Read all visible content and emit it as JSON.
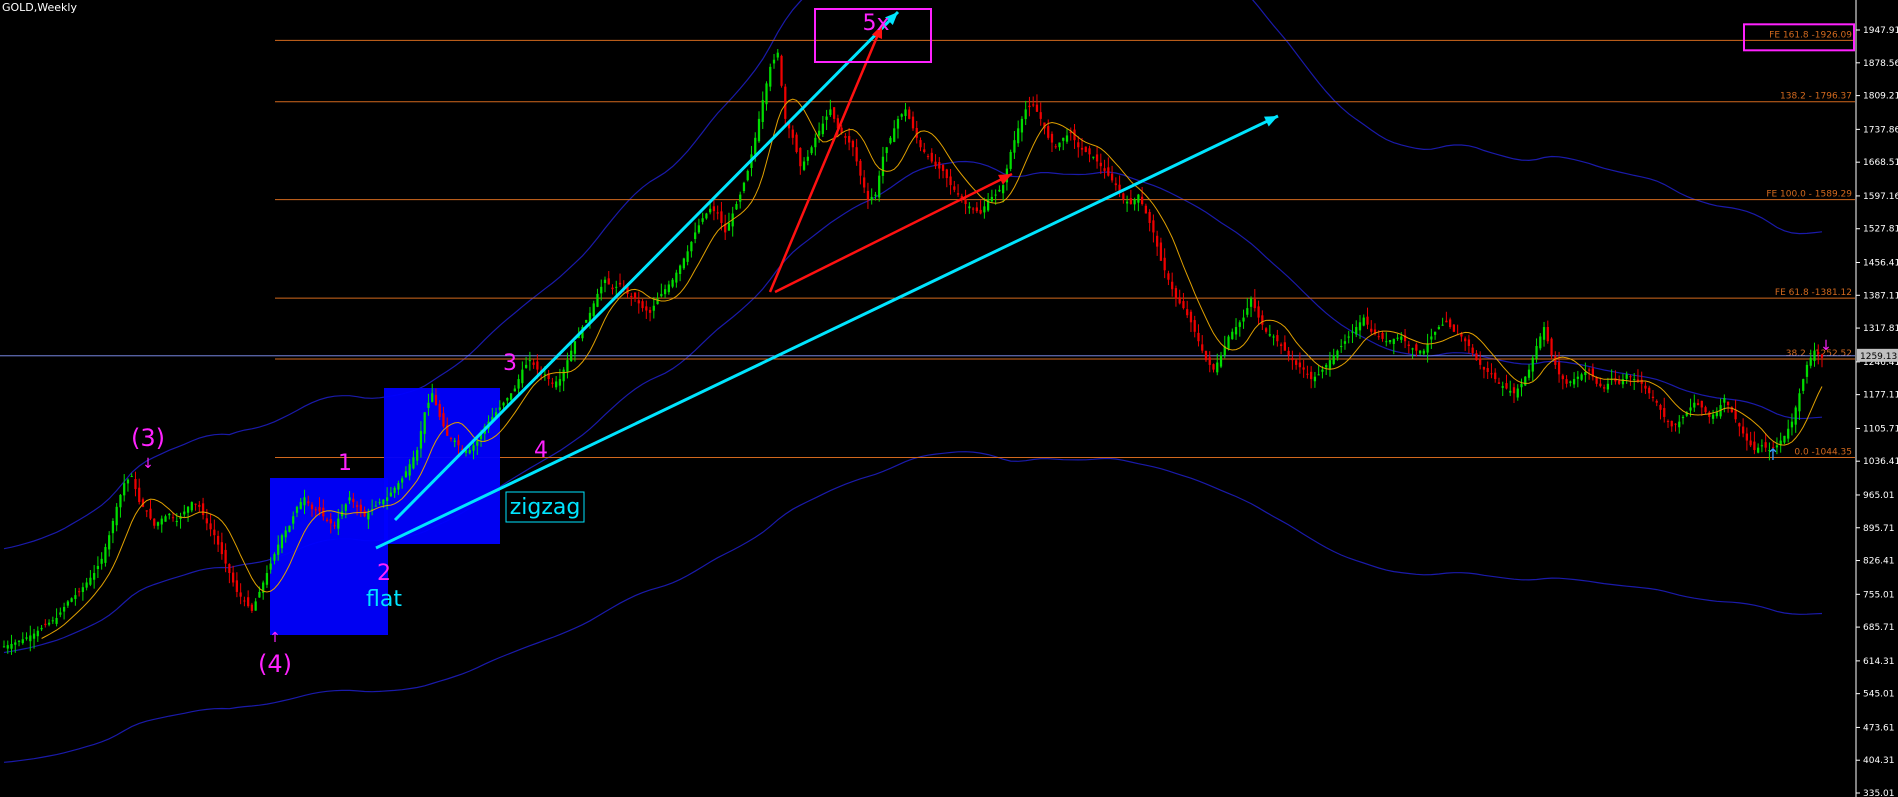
{
  "window": {
    "symbol_title": "GOLD,Weekly"
  },
  "colors": {
    "background": "#000000",
    "bull_candle": "#00dd00",
    "bear_candle": "#ee0000",
    "moving_average": "#e0a000",
    "bollinger": "#1a1aaa",
    "fib_line": "#d2691e",
    "trend_line": "#00e5ff",
    "red_line": "#ff1111",
    "wave_label": "#ff22ff",
    "box_fill": "#0000ff",
    "price_axis_text": "#ffffff",
    "current_price_bg": "#c0c0c0"
  },
  "chart_data": {
    "type": "candlestick",
    "symbol": "GOLD",
    "timeframe": "Weekly",
    "ylim": [
      335.01,
      2016.0
    ],
    "current_price": 1259.13,
    "y_ticks": [
      "1947.91",
      "1878.56",
      "1809.21",
      "1737.86",
      "1668.51",
      "1597.16",
      "1527.81",
      "1456.41",
      "1387.11",
      "1317.81",
      "1246.41",
      "1177.11",
      "1105.71",
      "1036.41",
      "965.01",
      "895.71",
      "826.41",
      "755.01",
      "685.71",
      "614.31",
      "545.01",
      "473.61",
      "404.31",
      "335.01"
    ],
    "fib_levels": [
      {
        "label": "FE 161.8 -1926.09",
        "price": 1926.09,
        "boxed": true
      },
      {
        "label": "138.2 - 1796.37",
        "price": 1796.37,
        "boxed": false
      },
      {
        "label": "FE 100.0 - 1589.29",
        "price": 1589.29,
        "boxed": false
      },
      {
        "label": "FE 61.8 -1381.12",
        "price": 1381.12,
        "boxed": false
      },
      {
        "label": "38.2 - 1252.52",
        "price": 1252.52,
        "boxed": false
      },
      {
        "label": "0.0 -1044.35",
        "price": 1044.35,
        "boxed": false
      }
    ],
    "wave_labels": [
      {
        "text": "(3)",
        "kind": "wave",
        "arrow": "down"
      },
      {
        "text": "(4)",
        "kind": "wave",
        "arrow": "up"
      },
      {
        "text": "1",
        "kind": "wave"
      },
      {
        "text": "2",
        "kind": "wave"
      },
      {
        "text": "3",
        "kind": "wave"
      },
      {
        "text": "4",
        "kind": "wave"
      },
      {
        "text": "5x",
        "kind": "wave",
        "boxed": true
      },
      {
        "text": "flat",
        "kind": "pattern"
      },
      {
        "text": "zigzag",
        "kind": "pattern",
        "boxed": true
      }
    ],
    "close_path": [
      [
        0,
        645
      ],
      [
        2,
        650
      ],
      [
        5,
        660
      ],
      [
        8,
        672
      ],
      [
        11,
        690
      ],
      [
        14,
        705
      ],
      [
        17,
        740
      ],
      [
        20,
        760
      ],
      [
        22,
        780
      ],
      [
        24,
        800
      ],
      [
        26,
        830
      ],
      [
        28,
        880
      ],
      [
        30,
        940
      ],
      [
        32,
        990
      ],
      [
        34,
        1005
      ],
      [
        36,
        950
      ],
      [
        38,
        930
      ],
      [
        40,
        900
      ],
      [
        42,
        915
      ],
      [
        44,
        925
      ],
      [
        46,
        910
      ],
      [
        48,
        930
      ],
      [
        50,
        950
      ],
      [
        52,
        940
      ],
      [
        54,
        905
      ],
      [
        56,
        880
      ],
      [
        58,
        840
      ],
      [
        60,
        800
      ],
      [
        62,
        760
      ],
      [
        64,
        740
      ],
      [
        66,
        720
      ],
      [
        68,
        760
      ],
      [
        70,
        800
      ],
      [
        72,
        840
      ],
      [
        74,
        880
      ],
      [
        76,
        900
      ],
      [
        78,
        940
      ],
      [
        80,
        960
      ],
      [
        82,
        935
      ],
      [
        84,
        930
      ],
      [
        86,
        910
      ],
      [
        88,
        900
      ],
      [
        90,
        930
      ],
      [
        92,
        960
      ],
      [
        94,
        940
      ],
      [
        96,
        920
      ],
      [
        98,
        935
      ],
      [
        100,
        950
      ],
      [
        102,
        960
      ],
      [
        104,
        980
      ],
      [
        106,
        1000
      ],
      [
        108,
        1030
      ],
      [
        110,
        1060
      ],
      [
        112,
        1140
      ],
      [
        114,
        1180
      ],
      [
        116,
        1130
      ],
      [
        118,
        1090
      ],
      [
        120,
        1080
      ],
      [
        122,
        1060
      ],
      [
        124,
        1060
      ],
      [
        126,
        1080
      ],
      [
        128,
        1110
      ],
      [
        130,
        1130
      ],
      [
        132,
        1150
      ],
      [
        134,
        1170
      ],
      [
        136,
        1190
      ],
      [
        138,
        1230
      ],
      [
        140,
        1250
      ],
      [
        142,
        1230
      ],
      [
        144,
        1220
      ],
      [
        146,
        1200
      ],
      [
        148,
        1210
      ],
      [
        150,
        1250
      ],
      [
        152,
        1290
      ],
      [
        154,
        1320
      ],
      [
        156,
        1350
      ],
      [
        158,
        1390
      ],
      [
        160,
        1420
      ],
      [
        162,
        1400
      ],
      [
        164,
        1410
      ],
      [
        166,
        1390
      ],
      [
        168,
        1380
      ],
      [
        170,
        1360
      ],
      [
        172,
        1350
      ],
      [
        174,
        1380
      ],
      [
        176,
        1400
      ],
      [
        178,
        1420
      ],
      [
        180,
        1450
      ],
      [
        182,
        1480
      ],
      [
        184,
        1520
      ],
      [
        186,
        1550
      ],
      [
        188,
        1570
      ],
      [
        190,
        1560
      ],
      [
        192,
        1520
      ],
      [
        194,
        1560
      ],
      [
        196,
        1600
      ],
      [
        198,
        1650
      ],
      [
        200,
        1720
      ],
      [
        202,
        1800
      ],
      [
        204,
        1870
      ],
      [
        206,
        1900
      ],
      [
        208,
        1760
      ],
      [
        210,
        1720
      ],
      [
        212,
        1660
      ],
      [
        214,
        1680
      ],
      [
        216,
        1720
      ],
      [
        218,
        1750
      ],
      [
        220,
        1780
      ],
      [
        222,
        1740
      ],
      [
        224,
        1720
      ],
      [
        226,
        1700
      ],
      [
        228,
        1640
      ],
      [
        230,
        1590
      ],
      [
        232,
        1600
      ],
      [
        234,
        1680
      ],
      [
        236,
        1720
      ],
      [
        238,
        1760
      ],
      [
        240,
        1780
      ],
      [
        242,
        1740
      ],
      [
        244,
        1700
      ],
      [
        246,
        1680
      ],
      [
        248,
        1660
      ],
      [
        250,
        1650
      ],
      [
        252,
        1620
      ],
      [
        254,
        1600
      ],
      [
        256,
        1580
      ],
      [
        258,
        1570
      ],
      [
        260,
        1560
      ],
      [
        262,
        1590
      ],
      [
        264,
        1600
      ],
      [
        266,
        1620
      ],
      [
        268,
        1690
      ],
      [
        270,
        1740
      ],
      [
        272,
        1780
      ],
      [
        274,
        1790
      ],
      [
        276,
        1760
      ],
      [
        278,
        1720
      ],
      [
        280,
        1700
      ],
      [
        282,
        1720
      ],
      [
        284,
        1730
      ],
      [
        286,
        1700
      ],
      [
        288,
        1690
      ],
      [
        290,
        1680
      ],
      [
        292,
        1660
      ],
      [
        294,
        1640
      ],
      [
        296,
        1620
      ],
      [
        298,
        1590
      ],
      [
        300,
        1580
      ],
      [
        302,
        1600
      ],
      [
        304,
        1560
      ],
      [
        306,
        1520
      ],
      [
        308,
        1460
      ],
      [
        310,
        1420
      ],
      [
        312,
        1380
      ],
      [
        314,
        1360
      ],
      [
        316,
        1330
      ],
      [
        318,
        1290
      ],
      [
        320,
        1250
      ],
      [
        322,
        1230
      ],
      [
        324,
        1260
      ],
      [
        326,
        1300
      ],
      [
        328,
        1320
      ],
      [
        330,
        1340
      ],
      [
        332,
        1380
      ],
      [
        334,
        1340
      ],
      [
        336,
        1310
      ],
      [
        338,
        1300
      ],
      [
        340,
        1280
      ],
      [
        342,
        1260
      ],
      [
        344,
        1240
      ],
      [
        346,
        1230
      ],
      [
        348,
        1210
      ],
      [
        350,
        1220
      ],
      [
        352,
        1240
      ],
      [
        354,
        1260
      ],
      [
        356,
        1280
      ],
      [
        358,
        1300
      ],
      [
        360,
        1320
      ],
      [
        362,
        1340
      ],
      [
        364,
        1310
      ],
      [
        366,
        1300
      ],
      [
        368,
        1290
      ],
      [
        370,
        1295
      ],
      [
        372,
        1300
      ],
      [
        374,
        1280
      ],
      [
        376,
        1270
      ],
      [
        378,
        1270
      ],
      [
        380,
        1300
      ],
      [
        382,
        1320
      ],
      [
        384,
        1330
      ],
      [
        386,
        1310
      ],
      [
        388,
        1300
      ],
      [
        390,
        1280
      ],
      [
        392,
        1250
      ],
      [
        394,
        1230
      ],
      [
        396,
        1220
      ],
      [
        398,
        1200
      ],
      [
        400,
        1190
      ],
      [
        402,
        1180
      ],
      [
        404,
        1200
      ],
      [
        406,
        1230
      ],
      [
        408,
        1280
      ],
      [
        410,
        1320
      ],
      [
        412,
        1260
      ],
      [
        414,
        1220
      ],
      [
        416,
        1200
      ],
      [
        418,
        1210
      ],
      [
        420,
        1220
      ],
      [
        422,
        1230
      ],
      [
        424,
        1200
      ],
      [
        426,
        1190
      ],
      [
        428,
        1210
      ],
      [
        430,
        1200
      ],
      [
        432,
        1220
      ],
      [
        434,
        1210
      ],
      [
        436,
        1200
      ],
      [
        438,
        1180
      ],
      [
        440,
        1160
      ],
      [
        442,
        1130
      ],
      [
        444,
        1110
      ],
      [
        446,
        1120
      ],
      [
        448,
        1140
      ],
      [
        450,
        1160
      ],
      [
        452,
        1150
      ],
      [
        454,
        1130
      ],
      [
        456,
        1140
      ],
      [
        458,
        1170
      ],
      [
        460,
        1140
      ],
      [
        462,
        1110
      ],
      [
        464,
        1080
      ],
      [
        466,
        1060
      ],
      [
        468,
        1070
      ],
      [
        470,
        1060
      ],
      [
        472,
        1070
      ],
      [
        474,
        1090
      ],
      [
        476,
        1120
      ],
      [
        478,
        1180
      ],
      [
        480,
        1240
      ],
      [
        482,
        1270
      ],
      [
        484,
        1255
      ]
    ]
  }
}
